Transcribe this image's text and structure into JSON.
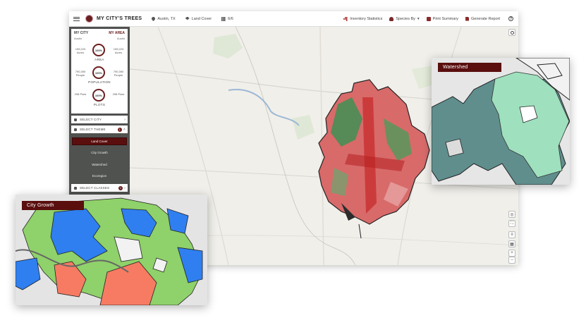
{
  "app": {
    "title": "MY CITY'S TREES"
  },
  "toolbar": {
    "location": "Austin, TX",
    "layer": "Land Cover",
    "grid": "6/6",
    "inventory": "Inventory Statistics",
    "species": "Species By",
    "print": "Print Summary",
    "report": "Generate Report",
    "help": "?"
  },
  "panel": {
    "my_city": "MY CITY",
    "my_area": "MY AREA",
    "city_name": "Austin",
    "area_name": "Austin",
    "stats": [
      {
        "left": "195,223 Acres",
        "pct": "100%",
        "right": "195,223 Acres",
        "label": "AREA"
      },
      {
        "left": "790,390 People",
        "pct": "100%",
        "right": "790,390 People",
        "label": "POPULATION"
      },
      {
        "left": "298 Plots",
        "pct": "100%",
        "right": "298 Plots",
        "label": "PLOTS"
      }
    ]
  },
  "sections": {
    "select_city": "SELECT CITY",
    "select_theme": "SELECT THEME",
    "theme_count": "1",
    "select_classes": "SELECT CLASSES",
    "classes_count": "1"
  },
  "themes": [
    "Land Cover",
    "City Growth",
    "Watershed",
    "Ecoregion"
  ],
  "cards": {
    "watershed": "Watershed",
    "city_growth": "City Growth"
  },
  "colors": {
    "accent": "#5a0e0e",
    "green": "#8fd16a",
    "blue": "#2f7ff0",
    "salmon": "#f77b63",
    "teal": "#5f8e8d",
    "mint": "#9fe0be"
  }
}
